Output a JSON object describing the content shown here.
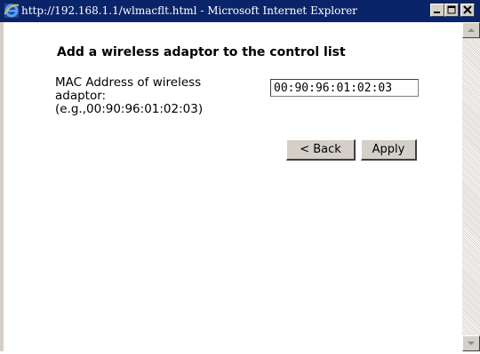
{
  "window": {
    "title": "http://192.168.1.1/wlmacflt.html - Microsoft Internet Explorer"
  },
  "icons": {
    "app": "internet-explorer-icon",
    "minimize": "minimize-icon",
    "maximize": "maximize-icon",
    "close": "close-icon",
    "scroll_up": "arrow-up-icon",
    "scroll_down": "arrow-down-icon"
  },
  "form": {
    "heading": "Add a wireless adaptor to the control list",
    "mac_label_line1": "MAC Address of wireless",
    "mac_label_line2": "adaptor:",
    "mac_example": "(e.g.,00:90:96:01:02:03)",
    "mac_value": "00:90:96:01:02:03",
    "back_label": "< Back",
    "apply_label": "Apply"
  },
  "colors": {
    "titlebar": "#0a246a",
    "face": "#d4d0c8"
  }
}
